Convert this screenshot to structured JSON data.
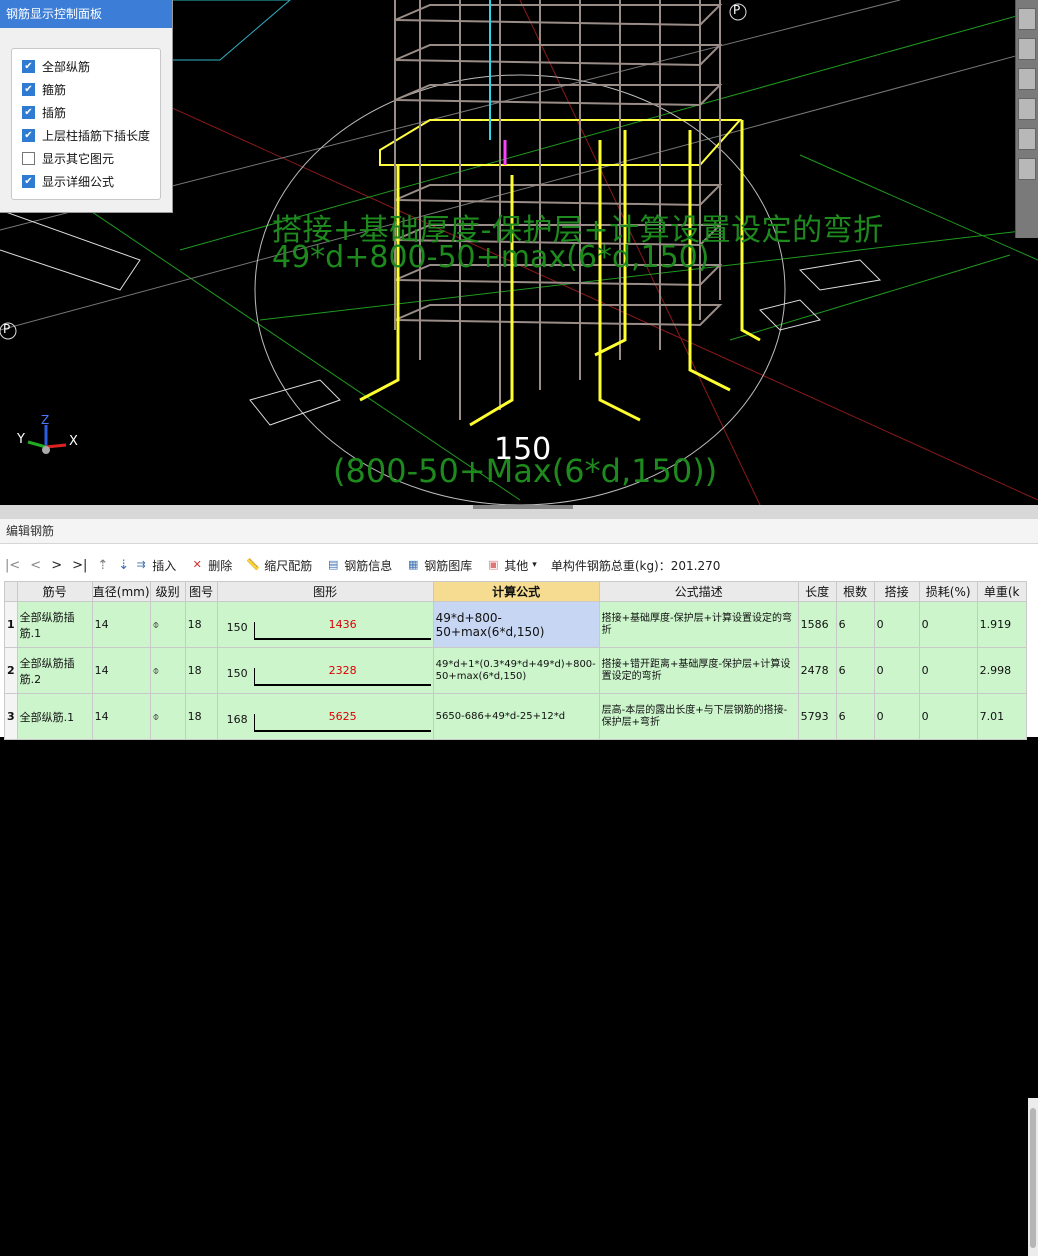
{
  "panel": {
    "title": "钢筋显示控制面板",
    "options": [
      {
        "label": "全部纵筋",
        "checked": true
      },
      {
        "label": "箍筋",
        "checked": true
      },
      {
        "label": "插筋",
        "checked": true
      },
      {
        "label": "上层柱插筋下插长度",
        "checked": true
      },
      {
        "label": "显示其它图元",
        "checked": false
      },
      {
        "label": "显示详细公式",
        "checked": true
      }
    ]
  },
  "viewport": {
    "formula_desc": "搭接+基础厚度-保护层+计算设置设定的弯折",
    "formula_expr": "49*d+800-50+max(6*d,150)",
    "formula_bottom": "(800-50+Max(6*d,150))",
    "dim_label": "150",
    "axis_x": "X",
    "axis_y": "Y",
    "axis_z": "Z",
    "marker_p": "P"
  },
  "editor": {
    "title": "编辑钢筋",
    "toolbar": {
      "insert": "插入",
      "delete": "删除",
      "scale": "缩尺配筋",
      "info": "钢筋信息",
      "library": "钢筋图库",
      "other": "其他",
      "total": "单构件钢筋总重(kg)：201.270"
    },
    "columns": [
      "筋号",
      "直径(mm)",
      "级别",
      "图号",
      "图形",
      "计算公式",
      "公式描述",
      "长度",
      "根数",
      "搭接",
      "损耗(%)",
      "单重(k"
    ],
    "rows": [
      {
        "idx": "1",
        "name": "全部纵筋插筋.1",
        "dia": "14",
        "grade": "⌽",
        "fig": "18",
        "left": "150",
        "mid": "1436",
        "formula": "49*d+800-50+max(6*d,150)",
        "desc": "搭接+基础厚度-保护层+计算设置设定的弯折",
        "len": "1586",
        "count": "6",
        "lap": "0",
        "loss": "0",
        "unit": "1.919"
      },
      {
        "idx": "2",
        "name": "全部纵筋插筋.2",
        "dia": "14",
        "grade": "⌽",
        "fig": "18",
        "left": "150",
        "mid": "2328",
        "formula": "49*d+1*(0.3*49*d+49*d)+800-50+max(6*d,150)",
        "desc": "搭接+错开距离+基础厚度-保护层+计算设置设定的弯折",
        "len": "2478",
        "count": "6",
        "lap": "0",
        "loss": "0",
        "unit": "2.998"
      },
      {
        "idx": "3",
        "name": "全部纵筋.1",
        "dia": "14",
        "grade": "⌽",
        "fig": "18",
        "left": "168",
        "mid": "5625",
        "formula": "5650-686+49*d-25+12*d",
        "desc": "层高-本层的露出长度+与下层钢筋的搭接-保护层+弯折",
        "len": "5793",
        "count": "6",
        "lap": "0",
        "loss": "0",
        "unit": "7.01"
      }
    ]
  }
}
